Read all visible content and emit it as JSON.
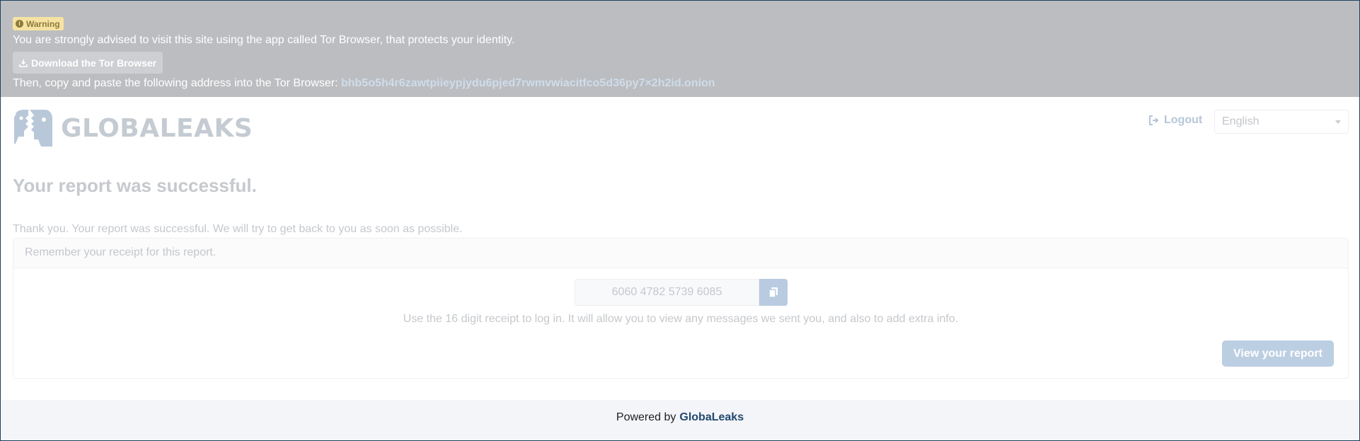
{
  "banner": {
    "warning_label": "Warning",
    "warning_icon": "info-circle-icon",
    "advice_text": "You are strongly advised to visit this site using the app called Tor Browser, that protects your identity.",
    "download_label": "Download the Tor Browser",
    "download_icon": "download-icon",
    "address_prefix": "Then, copy and paste the following address into the Tor Browser:",
    "onion_address": "bhb5o5h4r6zawtpiieypjydu6pjed7rwmvwiacitfco5d36py7×2h2id.onion"
  },
  "header": {
    "logo_text": "GLOBALEAKS",
    "logout_label": "Logout",
    "logout_icon": "sign-out-icon",
    "language": "English"
  },
  "main": {
    "title": "Your report was successful.",
    "thanks_text": "Thank you. Your report was successful. We will try to get back to you as soon as possible.",
    "receipt_header": "Remember your receipt for this report.",
    "receipt_value": "6060 4782 5739 6085",
    "copy_icon": "copy-icon",
    "receipt_help": "Use the 16 digit receipt to log in. It will allow you to view any messages we sent you, and also to add extra info.",
    "view_report_label": "View your report"
  },
  "footer": {
    "powered_by": "Powered by",
    "brand": "GlobaLeaks"
  },
  "colors": {
    "banner_bg": "#bbbdc0",
    "accent": "#21486e",
    "button_disabled": "#bccee2",
    "warning_badge": "#f6e3a3"
  }
}
